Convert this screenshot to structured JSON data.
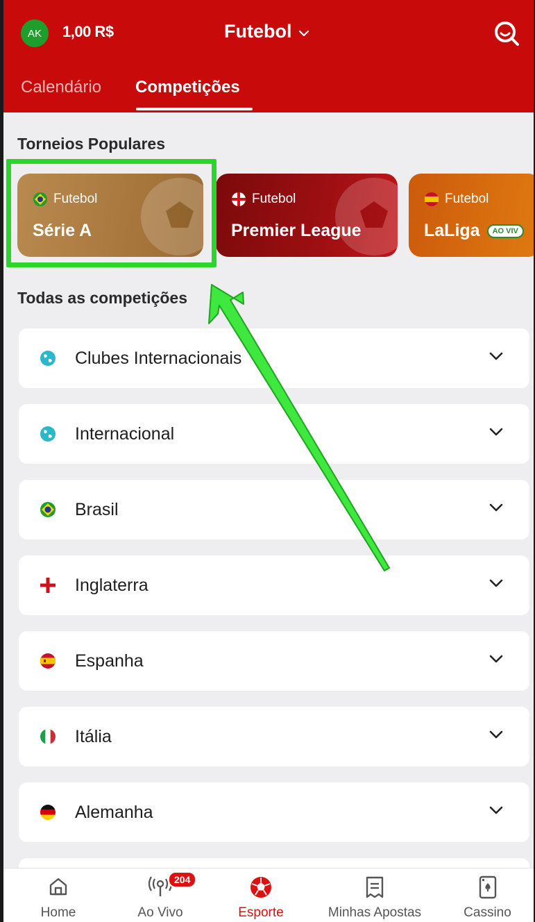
{
  "header": {
    "avatar_initials": "AK",
    "balance": "1,00 R$",
    "sport": "Futebol",
    "tabs": [
      {
        "label": "Calendário",
        "active": false
      },
      {
        "label": "Competições",
        "active": true
      }
    ],
    "colors": {
      "header_bg": "#c80a0a",
      "avatar_bg": "#1f9e2c"
    }
  },
  "popular": {
    "title": "Torneios Populares",
    "cards": [
      {
        "sport": "Futebol",
        "name": "Série A",
        "flag": "brazil-flag-icon",
        "color": "#b08245",
        "highlighted": true
      },
      {
        "sport": "Futebol",
        "name": "Premier League",
        "flag": "england-flag-icon",
        "color": "#8e0d10"
      },
      {
        "sport": "Futebol",
        "name": "LaLiga",
        "flag": "spain-flag-icon",
        "badge": "AO VIV",
        "color": "#d96a0e"
      }
    ]
  },
  "competitions": {
    "title": "Todas as competições",
    "items": [
      {
        "label": "Clubes Internacionais",
        "icon": "globe-icon"
      },
      {
        "label": "Internacional",
        "icon": "globe-icon"
      },
      {
        "label": "Brasil",
        "icon": "brazil-flag-icon"
      },
      {
        "label": "Inglaterra",
        "icon": "england-flag-icon"
      },
      {
        "label": "Espanha",
        "icon": "spain-flag-icon"
      },
      {
        "label": "Itália",
        "icon": "italy-flag-icon"
      },
      {
        "label": "Alemanha",
        "icon": "germany-flag-icon"
      }
    ]
  },
  "bottom_nav": [
    {
      "label": "Home",
      "icon": "home-icon"
    },
    {
      "label": "Ao Vivo",
      "icon": "live-broadcast-icon",
      "badge": "204"
    },
    {
      "label": "Esporte",
      "icon": "soccer-ball-icon",
      "active": true
    },
    {
      "label": "Minhas Apostas",
      "icon": "receipt-icon"
    },
    {
      "label": "Cassino",
      "icon": "playing-card-icon"
    }
  ],
  "annotation": {
    "highlight_color": "#2bd62b"
  }
}
